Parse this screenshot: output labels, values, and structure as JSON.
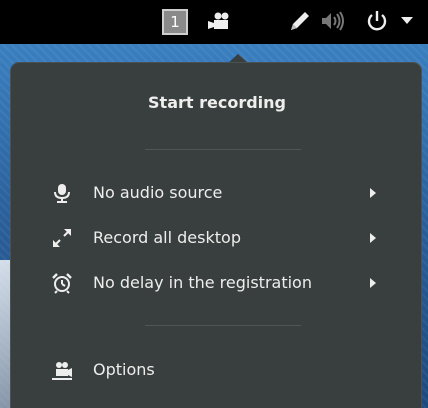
{
  "topbar": {
    "workspace_number": "1",
    "icons": [
      "camera-recorder-icon",
      "pen-icon",
      "volume-icon",
      "power-icon",
      "chevron-down-icon"
    ]
  },
  "menu": {
    "title": "Start recording",
    "items": [
      {
        "label": "No audio source",
        "icon": "microphone-icon",
        "submenu": true
      },
      {
        "label": "Record all desktop",
        "icon": "expand-arrows-icon",
        "submenu": true
      },
      {
        "label": "No delay in the registration",
        "icon": "alarm-clock-icon",
        "submenu": true
      }
    ],
    "options_label": "Options"
  },
  "colors": {
    "panel": "#000000",
    "menu_bg": "#393f3f",
    "text": "#eeeeec",
    "desktop": "#2a6aa8"
  }
}
